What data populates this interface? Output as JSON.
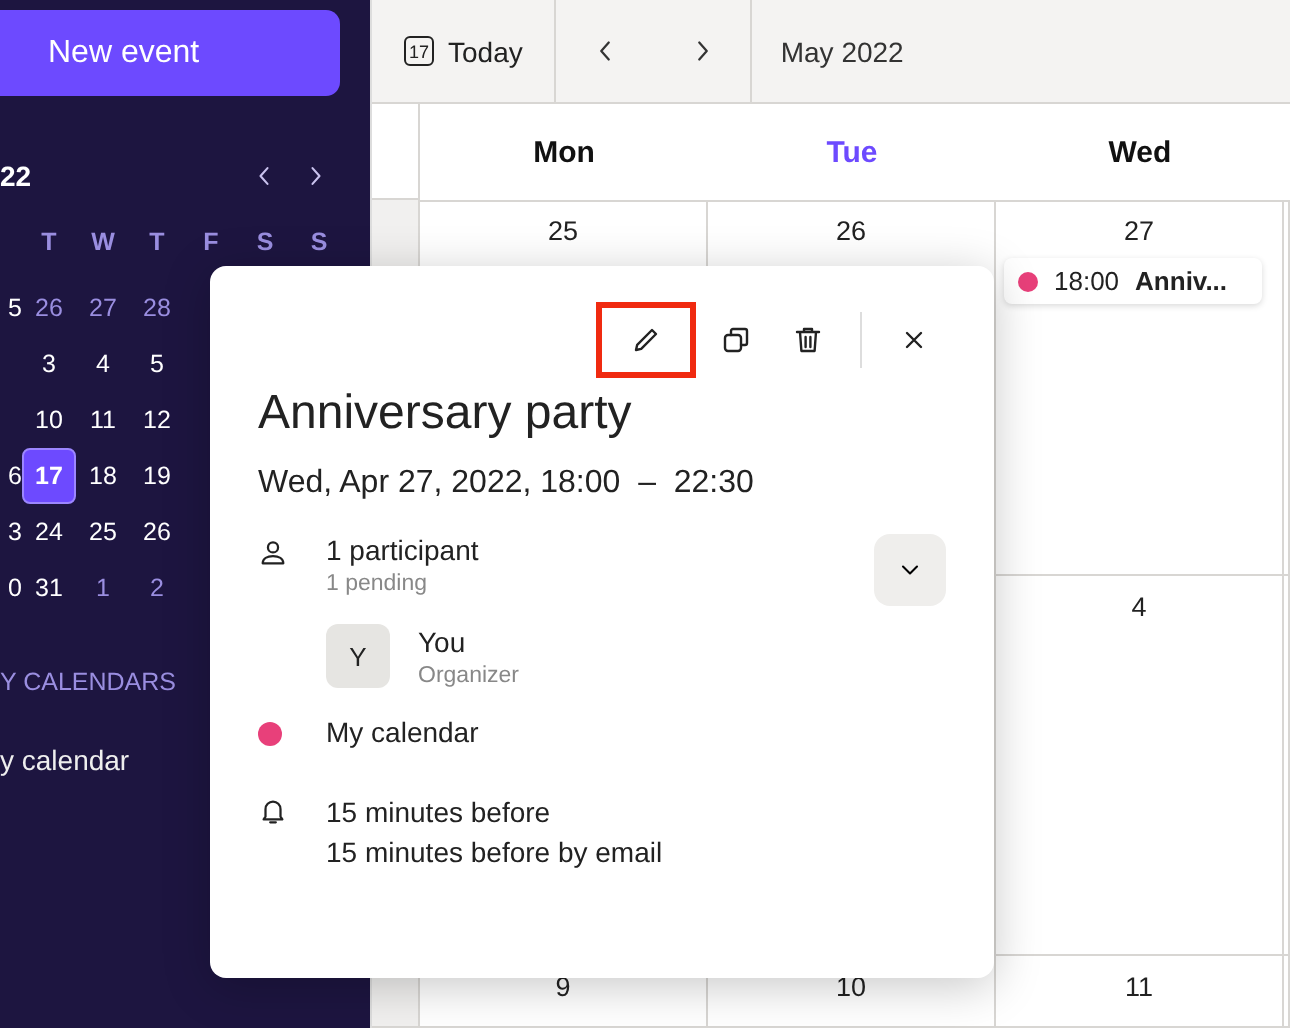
{
  "sidebar": {
    "new_event_button": "New event",
    "mini_calendar": {
      "title": "22",
      "weekdays": [
        "T",
        "W",
        "T",
        "F",
        "S",
        "S"
      ],
      "weeks": [
        {
          "edge": "5",
          "days": [
            {
              "label": "26",
              "muted": true,
              "selected": false
            },
            {
              "label": "27",
              "muted": true,
              "selected": false
            },
            {
              "label": "28",
              "muted": true,
              "selected": false
            }
          ]
        },
        {
          "days": [
            {
              "label": "3",
              "muted": false,
              "selected": false
            },
            {
              "label": "4",
              "muted": false,
              "selected": false
            },
            {
              "label": "5",
              "muted": false,
              "selected": false
            }
          ]
        },
        {
          "days": [
            {
              "label": "10",
              "muted": false,
              "selected": false
            },
            {
              "label": "11",
              "muted": false,
              "selected": false
            },
            {
              "label": "12",
              "muted": false,
              "selected": false
            }
          ]
        },
        {
          "edge": "6",
          "days": [
            {
              "label": "17",
              "muted": false,
              "selected": true
            },
            {
              "label": "18",
              "muted": false,
              "selected": false
            },
            {
              "label": "19",
              "muted": false,
              "selected": false
            }
          ]
        },
        {
          "edge": "3",
          "days": [
            {
              "label": "24",
              "muted": false,
              "selected": false
            },
            {
              "label": "25",
              "muted": false,
              "selected": false
            },
            {
              "label": "26",
              "muted": false,
              "selected": false
            }
          ]
        },
        {
          "edge": "0",
          "days": [
            {
              "label": "31",
              "muted": false,
              "selected": false
            },
            {
              "label": "1",
              "muted": true,
              "selected": false
            },
            {
              "label": "2",
              "muted": true,
              "selected": false
            }
          ]
        }
      ]
    },
    "section_title": "Y CALENDARS",
    "calendars": [
      {
        "label": "y calendar"
      }
    ]
  },
  "toolbar": {
    "today_icon_number": "17",
    "today_button": "Today",
    "period": "May 2022"
  },
  "weekdays": [
    {
      "label": "Mon",
      "today": false
    },
    {
      "label": "Tue",
      "today": true
    },
    {
      "label": "Wed",
      "today": false
    }
  ],
  "weeks": [
    {
      "mon": {
        "label": "25"
      },
      "tue": {
        "label": "26"
      },
      "wed": {
        "label": "27",
        "events": [
          {
            "time": "18:00 **Anniv...**",
            "color": "#e8407a"
          }
        ]
      }
    },
    {
      "wed": {
        "label": "4"
      }
    },
    {
      "mon": {
        "label": "9"
      },
      "tue": {
        "label": "10"
      },
      "wed": {
        "label": "11"
      }
    }
  ],
  "popover": {
    "actions": [
      {
        "kind": "edit",
        "highlighted": true
      },
      {
        "kind": "duplicate",
        "highlighted": false
      },
      {
        "kind": "delete",
        "highlighted": false
      },
      {
        "kind": "close",
        "highlighted": false
      }
    ],
    "title": "Anniversary party",
    "datetime": "Wed, Apr 27, 2022, 18:00  –  22:30",
    "participants": {
      "count": "1 participant",
      "pending": "1 pending",
      "expanded": false,
      "attendees": [
        {
          "initial": "Y",
          "name": "You",
          "role": "Organizer"
        }
      ]
    },
    "calendar": {
      "label": "My calendar",
      "color": "#e8407a"
    },
    "reminders": [
      "15 minutes before",
      "15 minutes before by email"
    ]
  }
}
